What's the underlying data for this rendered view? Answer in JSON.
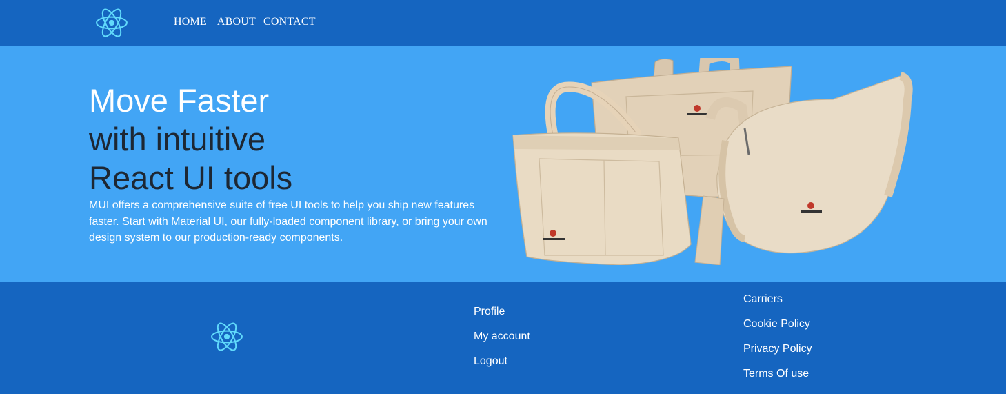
{
  "navbar": {
    "logo_icon": "react-atom-icon",
    "links": [
      "HOME",
      "ABOUT",
      "CONTACT"
    ]
  },
  "hero": {
    "title_accent": "Move Faster",
    "title_line2": "with intuitive",
    "title_line3": "React UI tools",
    "description": "MUI offers a comprehensive suite of free UI tools to help you ship new features faster. Start with Material UI, our fully-loaded component library, or bring your own design system to our production-ready components.",
    "image_icon": "canvas-tote-bags-photo"
  },
  "footer": {
    "logo_icon": "react-atom-icon",
    "account_links": [
      "Profile",
      "My account",
      "Logout"
    ],
    "legal_links": [
      "Carriers",
      "Cookie Policy",
      "Privacy Policy",
      "Terms Of use"
    ]
  },
  "colors": {
    "navbar_bg": "#1565c0",
    "hero_bg": "#42a5f5",
    "logo": "#61dafb",
    "title_dark": "#1d2733"
  }
}
